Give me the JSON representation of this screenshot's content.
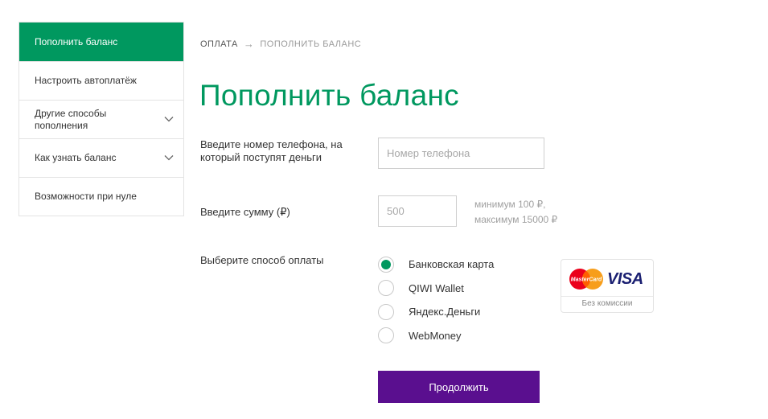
{
  "sidebar": {
    "items": [
      {
        "label": "Пополнить баланс",
        "active": true
      },
      {
        "label": "Настроить автоплатёж"
      },
      {
        "label": "Другие способы пополнения",
        "expandable": true
      },
      {
        "label": "Как узнать баланс",
        "expandable": true
      },
      {
        "label": "Возможности при нуле"
      }
    ]
  },
  "breadcrumb": {
    "parent": "ОПЛАТА",
    "separator": "→",
    "current": "ПОПОЛНИТЬ БАЛАНС"
  },
  "page_title": "Пополнить баланс",
  "phone": {
    "label": "Введите номер телефона, на который поступят деньги",
    "placeholder": "Номер телефона",
    "value": ""
  },
  "amount": {
    "label": "Введите сумму (₽)",
    "placeholder": "500",
    "value": "",
    "hint_min": "минимум 100 ₽,",
    "hint_max": "максимум 15000 ₽"
  },
  "payment": {
    "label": "Выберите способ оплаты",
    "methods": [
      {
        "label": "Банковская карта",
        "checked": true
      },
      {
        "label": "QIWI Wallet",
        "checked": false
      },
      {
        "label": "Яндекс.Деньги",
        "checked": false
      },
      {
        "label": "WebMoney",
        "checked": false
      }
    ],
    "card_badge": {
      "mastercard_text": "MasterCard",
      "visa_text": "VISA",
      "note": "Без комиссии"
    }
  },
  "submit_label": "Продолжить",
  "colors": {
    "accent": "#00985f",
    "button": "#5a0f8f",
    "border": "#e3e3e3"
  }
}
